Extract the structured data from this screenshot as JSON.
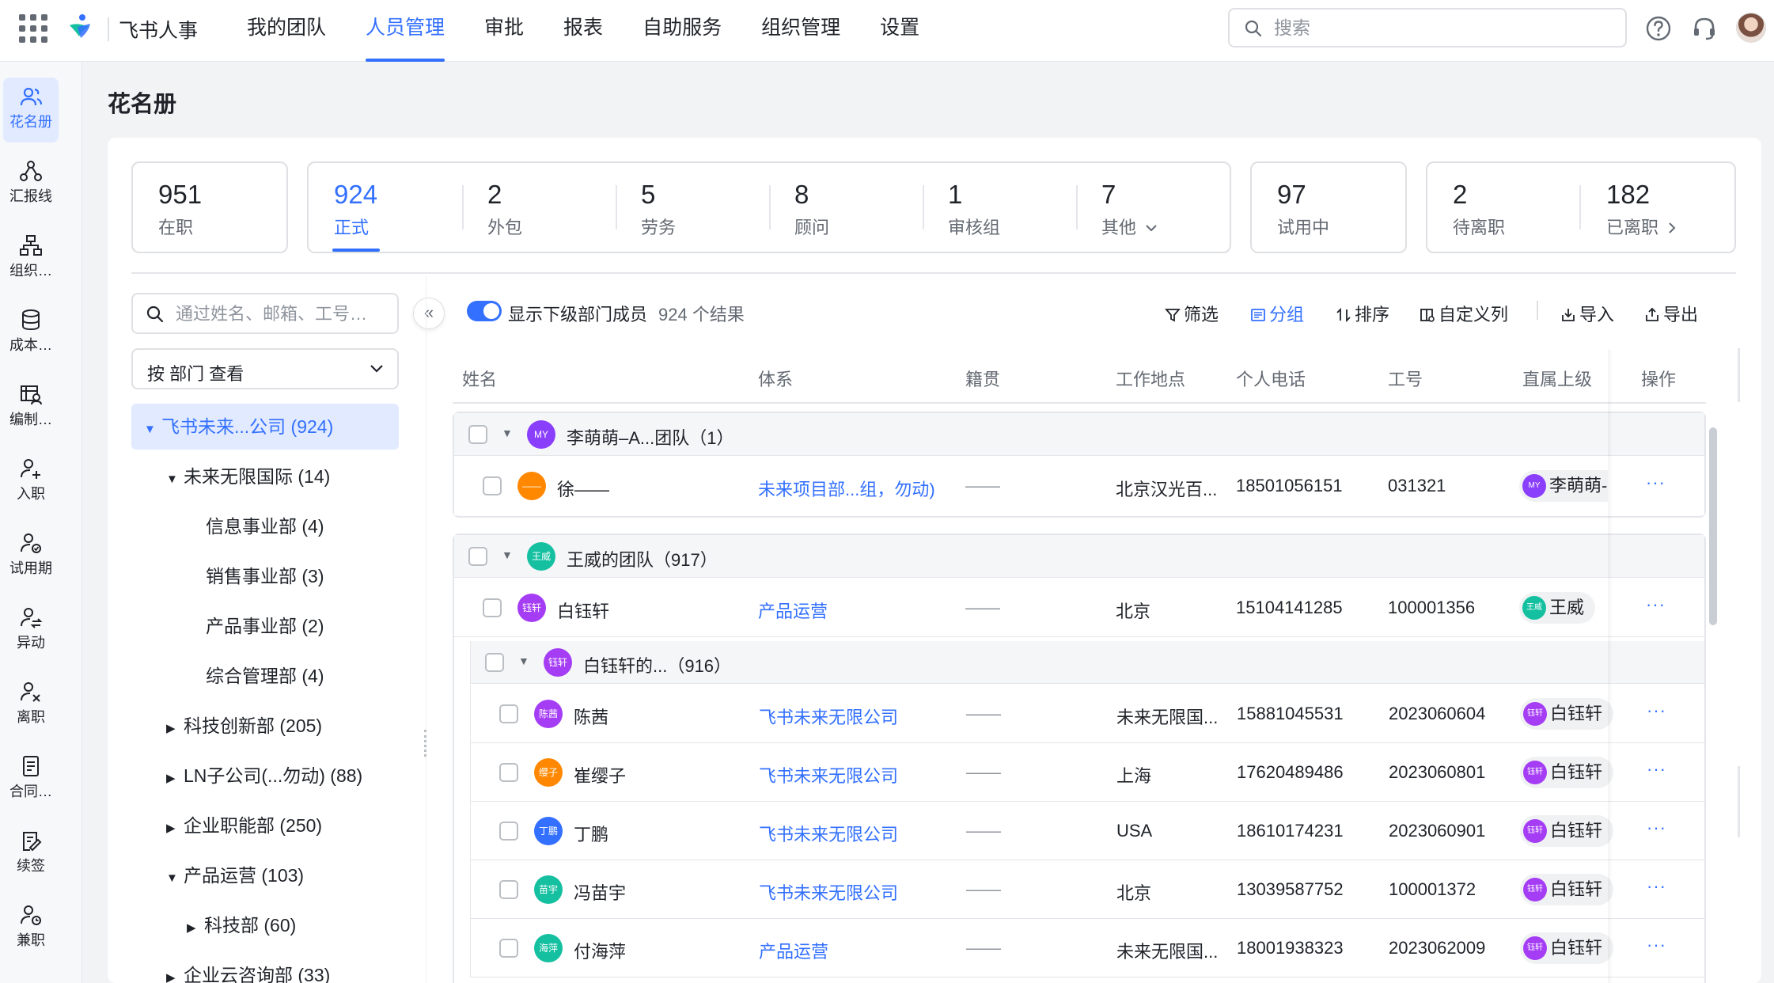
{
  "topbar": {
    "app_name": "飞书人事",
    "nav": [
      "我的团队",
      "人员管理",
      "审批",
      "报表",
      "自助服务",
      "组织管理",
      "设置"
    ],
    "active_nav": 1,
    "search_placeholder": "搜索"
  },
  "rail": [
    {
      "label": "花名册",
      "icon": "users-icon",
      "active": true
    },
    {
      "label": "汇报线",
      "icon": "hierarchy-icon"
    },
    {
      "label": "组织…",
      "icon": "org-chart-icon"
    },
    {
      "label": "成本…",
      "icon": "database-icon"
    },
    {
      "label": "编制…",
      "icon": "headcount-icon"
    },
    {
      "label": "入职",
      "icon": "user-add-icon"
    },
    {
      "label": "试用期",
      "icon": "user-check-icon"
    },
    {
      "label": "异动",
      "icon": "user-transfer-icon"
    },
    {
      "label": "离职",
      "icon": "user-remove-icon"
    },
    {
      "label": "合同…",
      "icon": "contract-icon"
    },
    {
      "label": "续签",
      "icon": "renew-icon"
    },
    {
      "label": "兼职",
      "icon": "user-clock-icon"
    }
  ],
  "page_title": "花名册",
  "stats": {
    "onboard": {
      "num": "951",
      "label": "在职"
    },
    "types": [
      {
        "num": "924",
        "label": "正式",
        "active": true
      },
      {
        "num": "2",
        "label": "外包"
      },
      {
        "num": "5",
        "label": "劳务"
      },
      {
        "num": "8",
        "label": "顾问"
      },
      {
        "num": "1",
        "label": "审核组"
      },
      {
        "num": "7",
        "label": "其他"
      }
    ],
    "probation": {
      "num": "97",
      "label": "试用中"
    },
    "leaving": [
      {
        "num": "2",
        "label": "待离职"
      },
      {
        "num": "182",
        "label": "已离职"
      }
    ]
  },
  "tree": {
    "search_placeholder": "通过姓名、邮箱、工号…",
    "view_select": "按 部门 查看",
    "items": [
      {
        "label": "飞书未来...公司 (924)",
        "level": 0,
        "caret": "▼",
        "selected": true
      },
      {
        "label": "未来无限国际 (14)",
        "level": 1,
        "caret": "▼"
      },
      {
        "label": "信息事业部 (4)",
        "level": 2,
        "caret": ""
      },
      {
        "label": "销售事业部 (3)",
        "level": 2,
        "caret": ""
      },
      {
        "label": "产品事业部 (2)",
        "level": 2,
        "caret": ""
      },
      {
        "label": "综合管理部 (4)",
        "level": 2,
        "caret": ""
      },
      {
        "label": "科技创新部 (205)",
        "level": 1,
        "caret": "▶"
      },
      {
        "label": "LN子公司(...勿动) (88)",
        "level": 1,
        "caret": "▶"
      },
      {
        "label": "企业职能部 (250)",
        "level": 1,
        "caret": "▶"
      },
      {
        "label": "产品运营 (103)",
        "level": 1,
        "caret": "▼"
      },
      {
        "label": "科技部 (60)",
        "level": 2,
        "caret": "▶"
      },
      {
        "label": "企业云咨询部 (33)",
        "level": 1,
        "caret": "▶"
      }
    ]
  },
  "toolbar": {
    "toggle_label": "显示下级部门成员",
    "result_count": "924 个结果",
    "filter": "筛选",
    "group": "分组",
    "sort": "排序",
    "columns": "自定义列",
    "import": "导入",
    "export": "导出"
  },
  "table": {
    "headers": [
      "姓名",
      "体系",
      "籍贯",
      "工作地点",
      "个人电话",
      "工号",
      "直属上级",
      "操作"
    ],
    "groups": [
      {
        "avatar": "MY",
        "avatar_color": "#8a3ffc",
        "title": "李萌萌–A...团队（1）",
        "rows": [
          {
            "avatar": "——",
            "avatar_color": "#ff8800",
            "name": "徐——",
            "system": "未来项目部...组，勿动)",
            "origin": "——",
            "location": "北京汉光百...",
            "phone": "18501056151",
            "id": "031321",
            "manager_avatar": "MY",
            "manager_color": "#8a3ffc",
            "manager": "李萌萌-"
          }
        ]
      },
      {
        "avatar": "王威",
        "avatar_color": "#14c0a0",
        "title": "王威的团队（917）",
        "rows": [
          {
            "avatar": "钰轩",
            "avatar_color": "#a53df5",
            "name": "白钰轩",
            "system": "产品运营",
            "origin": "——",
            "location": "北京",
            "phone": "15104141285",
            "id": "100001356",
            "manager_avatar": "王威",
            "manager_color": "#14c0a0",
            "manager": "王威"
          }
        ],
        "subgroup": {
          "avatar": "钰轩",
          "avatar_color": "#a53df5",
          "title": "白钰轩的...（916）",
          "rows": [
            {
              "avatar": "陈茜",
              "avatar_color": "#a53df5",
              "name": "陈茜",
              "system": "飞书未来无限公司",
              "origin": "——",
              "location": "未来无限国...",
              "phone": "15881045531",
              "id": "2023060604",
              "manager_avatar": "钰轩",
              "manager_color": "#a53df5",
              "manager": "白钰轩"
            },
            {
              "avatar": "缨子",
              "avatar_color": "#ff8800",
              "name": "崔缨子",
              "system": "飞书未来无限公司",
              "origin": "——",
              "location": "上海",
              "phone": "17620489486",
              "id": "2023060801",
              "manager_avatar": "钰轩",
              "manager_color": "#a53df5",
              "manager": "白钰轩"
            },
            {
              "avatar": "丁鹏",
              "avatar_color": "#3370ff",
              "name": "丁鹏",
              "system": "飞书未来无限公司",
              "origin": "——",
              "location": "USA",
              "phone": "18610174231",
              "id": "2023060901",
              "manager_avatar": "钰轩",
              "manager_color": "#a53df5",
              "manager": "白钰轩"
            },
            {
              "avatar": "苗宇",
              "avatar_color": "#14c0a0",
              "name": "冯苗宇",
              "system": "飞书未来无限公司",
              "origin": "——",
              "location": "北京",
              "phone": "13039587752",
              "id": "100001372",
              "manager_avatar": "钰轩",
              "manager_color": "#a53df5",
              "manager": "白钰轩"
            },
            {
              "avatar": "海萍",
              "avatar_color": "#14c0a0",
              "name": "付海萍",
              "system": "产品运营",
              "origin": "——",
              "location": "未来无限国...",
              "phone": "18001938323",
              "id": "2023062009",
              "manager_avatar": "钰轩",
              "manager_color": "#a53df5",
              "manager": "白钰轩"
            }
          ]
        }
      }
    ],
    "more_glyph": "···"
  }
}
